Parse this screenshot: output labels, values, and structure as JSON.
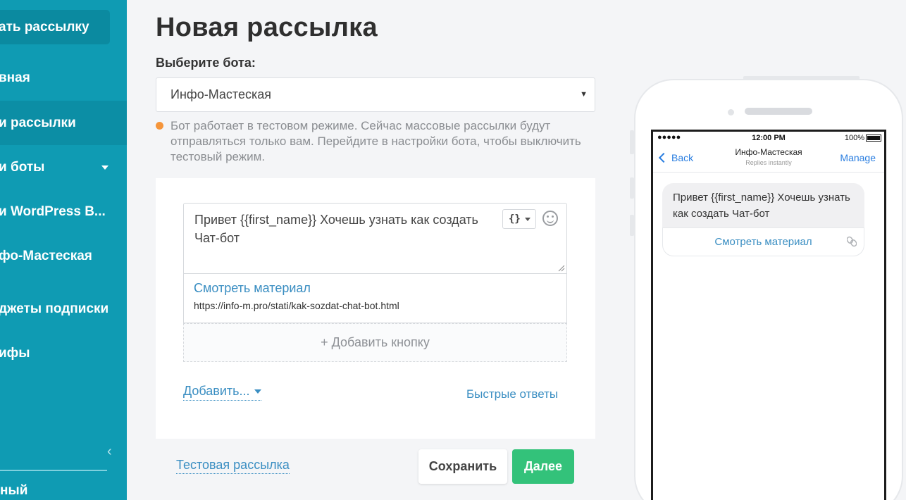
{
  "sidebar": {
    "new_broadcast": "ать рассылку",
    "items": [
      {
        "label": "вная"
      },
      {
        "label": "и рассылки"
      },
      {
        "label": "и боты"
      },
      {
        "label": "и WordPress B..."
      },
      {
        "label": "фо-Мастеская"
      },
      {
        "label": "джеты подписки"
      },
      {
        "label": "ифы"
      }
    ],
    "bottom": "ный"
  },
  "main": {
    "title": "Новая рассылка",
    "bot_label": "Выберите бота:",
    "bot_selected": "Инфо-Мастеская",
    "notice": "Бот работает в тестовом режиме. Сейчас массовые рассылки будут отправляться только вам. Перейдите в настройки бота, чтобы выключить тестовый режим.",
    "notice_color": "#f5953a",
    "message": "Привет  {{first_name}} Хочешь узнать как создать Чат-бот",
    "var_button": "{}",
    "button": {
      "title": "Смотреть материал",
      "url": "https://info-m.pro/stati/kak-sozdat-chat-bot.html"
    },
    "add_button": "+ Добавить кнопку",
    "add_more": "Добавить...",
    "quick_replies": "Быстрые ответы",
    "test_send": "Тестовая рассылка",
    "save": "Сохранить",
    "next": "Далее"
  },
  "phone": {
    "signal": "●●●●● ",
    "time": "12:00 PM",
    "battery": "100%",
    "back": "Back",
    "bot_name": "Инфо-Мастеская",
    "subtitle": "Replies instantly",
    "manage": "Manage",
    "message": "Привет  {{first_name}} Хочешь узнать как создать Чат-бот",
    "button": "Смотреть материал"
  },
  "colors": {
    "sidebar": "#0f9bb3",
    "accent_link": "#3a8ec2",
    "primary_button": "#33c27a"
  }
}
